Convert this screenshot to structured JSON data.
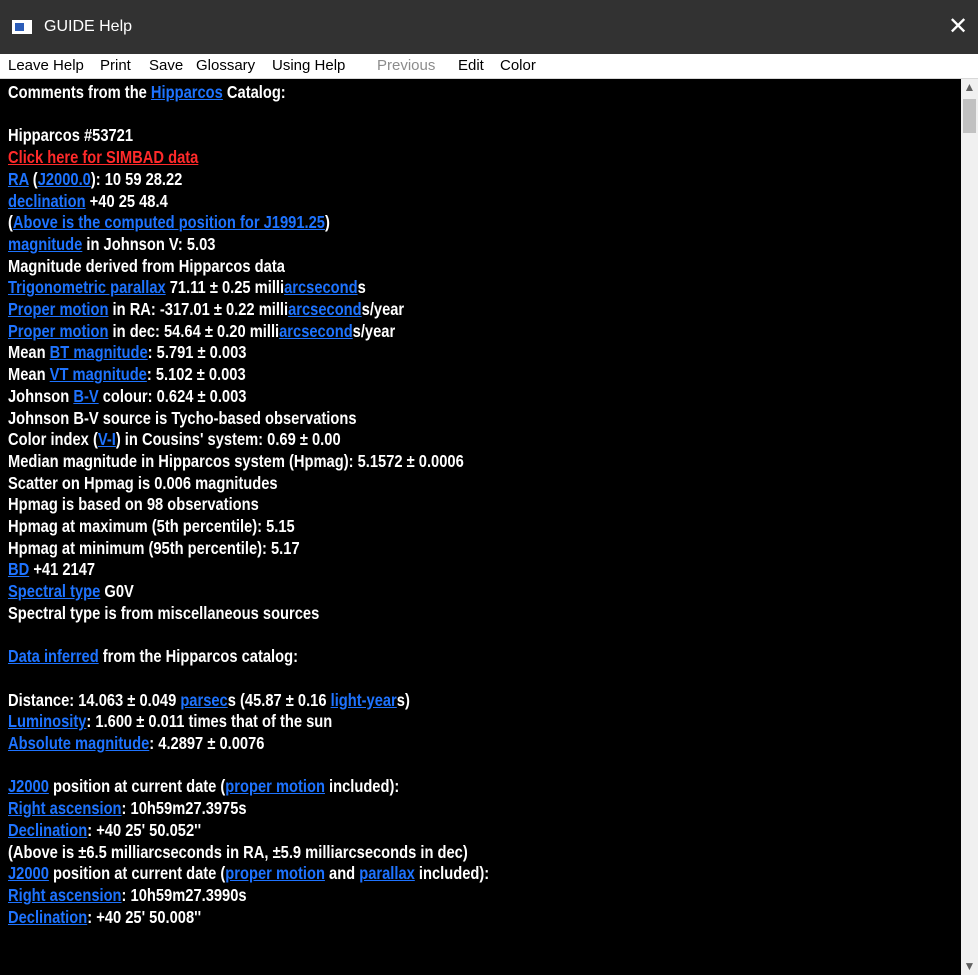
{
  "window": {
    "title": "GUIDE Help",
    "close_glyph": "✕"
  },
  "menu": [
    {
      "label": "Leave Help",
      "disabled": false
    },
    {
      "label": "Print",
      "disabled": false
    },
    {
      "label": "Save",
      "disabled": false
    },
    {
      "label": "Glossary",
      "disabled": false
    },
    {
      "label": "Using Help",
      "disabled": false
    },
    {
      "label": "Previous",
      "disabled": true
    },
    {
      "label": "Edit",
      "disabled": false
    },
    {
      "label": "Color",
      "disabled": false
    }
  ],
  "colors": {
    "link": "#1e73ff",
    "red_link": "#ff2a2a",
    "text": "#ffffff",
    "background": "#000000"
  },
  "lines": [
    [
      {
        "t": "Comments from the "
      },
      {
        "t": "Hipparcos",
        "k": "link"
      },
      {
        "t": " Catalog:"
      }
    ],
    [],
    [
      {
        "t": "Hipparcos #53721"
      }
    ],
    [
      {
        "t": "Click here for SIMBAD data",
        "k": "red"
      }
    ],
    [
      {
        "t": "RA",
        "k": "link"
      },
      {
        "t": " ("
      },
      {
        "t": "J2000.0",
        "k": "link"
      },
      {
        "t": "): 10 59 28.22"
      }
    ],
    [
      {
        "t": "declination",
        "k": "link"
      },
      {
        "t": " +40 25 48.4"
      }
    ],
    [
      {
        "t": "("
      },
      {
        "t": "Above is the computed position for J1991.25",
        "k": "link"
      },
      {
        "t": ")"
      }
    ],
    [
      {
        "t": "magnitude",
        "k": "link"
      },
      {
        "t": " in Johnson V: 5.03"
      }
    ],
    [
      {
        "t": "Magnitude derived from Hipparcos data"
      }
    ],
    [
      {
        "t": "Trigonometric parallax",
        "k": "link"
      },
      {
        "t": " 71.11 ± 0.25 milli"
      },
      {
        "t": "arcsecond",
        "k": "link"
      },
      {
        "t": "s"
      }
    ],
    [
      {
        "t": "Proper motion",
        "k": "link"
      },
      {
        "t": " in RA: -317.01 ± 0.22 milli"
      },
      {
        "t": "arcsecond",
        "k": "link"
      },
      {
        "t": "s/year"
      }
    ],
    [
      {
        "t": "Proper motion",
        "k": "link"
      },
      {
        "t": " in dec: 54.64 ± 0.20 milli"
      },
      {
        "t": "arcsecond",
        "k": "link"
      },
      {
        "t": "s/year"
      }
    ],
    [
      {
        "t": "Mean "
      },
      {
        "t": "BT magnitude",
        "k": "link"
      },
      {
        "t": ": 5.791 ± 0.003"
      }
    ],
    [
      {
        "t": "Mean "
      },
      {
        "t": "VT magnitude",
        "k": "link"
      },
      {
        "t": ": 5.102 ± 0.003"
      }
    ],
    [
      {
        "t": "Johnson "
      },
      {
        "t": "B-V",
        "k": "link"
      },
      {
        "t": " colour: 0.624 ± 0.003"
      }
    ],
    [
      {
        "t": "Johnson B-V source is Tycho-based observations"
      }
    ],
    [
      {
        "t": "Color index ("
      },
      {
        "t": "V-I",
        "k": "link"
      },
      {
        "t": ") in Cousins' system: 0.69 ± 0.00"
      }
    ],
    [
      {
        "t": "Median magnitude in Hipparcos system (Hpmag): 5.1572 ± 0.0006"
      }
    ],
    [
      {
        "t": "Scatter on Hpmag is 0.006 magnitudes"
      }
    ],
    [
      {
        "t": "Hpmag is based on 98 observations"
      }
    ],
    [
      {
        "t": "Hpmag at maximum (5th percentile): 5.15"
      }
    ],
    [
      {
        "t": "Hpmag at minimum (95th percentile): 5.17"
      }
    ],
    [
      {
        "t": "BD",
        "k": "link"
      },
      {
        "t": " +41 2147"
      }
    ],
    [
      {
        "t": "Spectral type",
        "k": "link"
      },
      {
        "t": " G0V"
      }
    ],
    [
      {
        "t": "Spectral type is from miscellaneous sources"
      }
    ],
    [],
    [
      {
        "t": "Data inferred",
        "k": "link"
      },
      {
        "t": " from the Hipparcos catalog:"
      }
    ],
    [],
    [
      {
        "t": "Distance: 14.063 ± 0.049 "
      },
      {
        "t": "parsec",
        "k": "link"
      },
      {
        "t": "s (45.87 ± 0.16 "
      },
      {
        "t": "light-year",
        "k": "link"
      },
      {
        "t": "s)"
      }
    ],
    [
      {
        "t": "Luminosity",
        "k": "link"
      },
      {
        "t": ": 1.600 ± 0.011 times that of the sun"
      }
    ],
    [
      {
        "t": "Absolute magnitude",
        "k": "link"
      },
      {
        "t": ": 4.2897 ± 0.0076"
      }
    ],
    [],
    [
      {
        "t": "J2000",
        "k": "link"
      },
      {
        "t": " position at current date ("
      },
      {
        "t": "proper motion",
        "k": "link"
      },
      {
        "t": " included):"
      }
    ],
    [
      {
        "t": "Right ascension",
        "k": "link"
      },
      {
        "t": ": 10h59m27.3975s"
      }
    ],
    [
      {
        "t": "Declination",
        "k": "link"
      },
      {
        "t": ": +40 25' 50.052''"
      }
    ],
    [
      {
        "t": "(Above is ±6.5 milliarcseconds in RA, ±5.9 milliarcseconds in dec)"
      }
    ],
    [
      {
        "t": "J2000",
        "k": "link"
      },
      {
        "t": " position at current date ("
      },
      {
        "t": "proper motion",
        "k": "link"
      },
      {
        "t": " and "
      },
      {
        "t": "parallax",
        "k": "link"
      },
      {
        "t": " included):"
      }
    ],
    [
      {
        "t": "Right ascension",
        "k": "link"
      },
      {
        "t": ": 10h59m27.3990s"
      }
    ],
    [
      {
        "t": "Declination",
        "k": "link"
      },
      {
        "t": ": +40 25' 50.008''"
      }
    ]
  ],
  "scrollbar": {
    "up_glyph": "▲",
    "down_glyph": "▼"
  }
}
